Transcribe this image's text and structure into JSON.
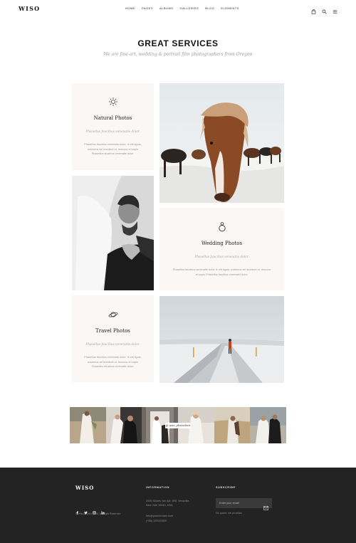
{
  "header": {
    "logo": "WISO",
    "nav": [
      "HOME",
      "PAGES",
      "ALBUMS",
      "GALLERIES",
      "BLOG",
      "ELEMENTS"
    ],
    "icons": [
      "bag-icon",
      "search-icon",
      "menu-icon"
    ]
  },
  "services": {
    "title": "GREAT SERVICES",
    "subtitle": "We are fine-art, wedding & portrait film photographers from Oregon",
    "cards": [
      {
        "icon": "sun-icon",
        "title": "Natural Photos",
        "subtitle": "Phasellus faucibus venenatis dolor.",
        "body": "Phasellus faucibus venenatis dolor. In elit ligula, maximus vel tincidunt ut, rhoncus et turpis Phasellus faucibus venenatis dolor."
      },
      {
        "icon": "ring-icon",
        "title": "Wedding Photos",
        "subtitle": "Phasellus faucibus venenatis dolor.",
        "body": "Phasellus faucibus venenatis dolor. In elit ligula, maximus vel tincidunt ut, rhoncus et turpis Phasellus faucibus venenatis dolor."
      },
      {
        "icon": "planet-icon",
        "title": "Travel Photos",
        "subtitle": "Phasellus faucibus venenatis dolor.",
        "body": "Phasellus faucibus venenatis dolor. In elit ligula, maximus vel tincidunt ut, rhoncus et turpis Phasellus faucibus venenatis dolor."
      }
    ]
  },
  "gallery": {
    "label": "@ wiso_photoshow"
  },
  "footer": {
    "logo": "WISO",
    "social": [
      "facebook-icon",
      "twitter-icon",
      "instagram-icon",
      "linkedin-icon"
    ],
    "copyright": "© Wiso Studio 2018. All Right Reserved",
    "information": {
      "heading": "INFORMATION",
      "address_line1": "2005 Stokes Isle Apt. 896, Venaville,",
      "address_line2": "New York 10010, USA",
      "email": "info@yourdomain.com",
      "phone": "(+68) 120034509"
    },
    "subscribe": {
      "heading": "SUBSCRIBE",
      "placeholder": "Enter your email",
      "note": "No spam, we promise"
    }
  },
  "colors": {
    "card_bg": "#faf7f4",
    "footer_bg": "#232323",
    "text_dark": "#222222",
    "text_muted": "#999999"
  }
}
